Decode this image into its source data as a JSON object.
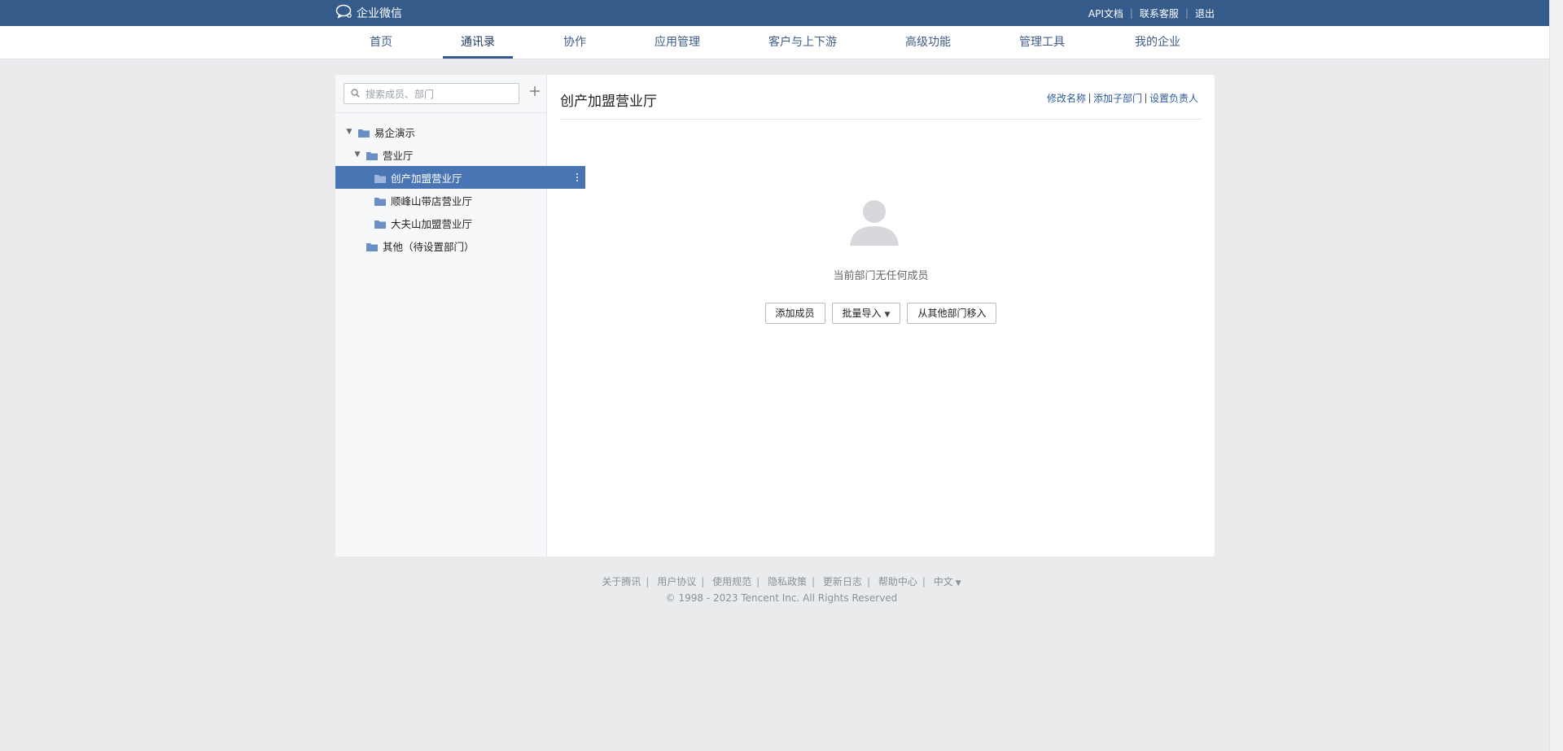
{
  "topbar": {
    "app_name": "企业微信",
    "links": [
      "API文档",
      "联系客服",
      "退出"
    ]
  },
  "nav": {
    "tabs": [
      "首页",
      "通讯录",
      "协作",
      "应用管理",
      "客户与上下游",
      "高级功能",
      "管理工具",
      "我的企业"
    ],
    "active": "通讯录"
  },
  "sidebar": {
    "search_placeholder": "搜索成员、部门",
    "tree": [
      {
        "label": "易企演示",
        "level": 0,
        "expanded": true
      },
      {
        "label": "营业厅",
        "level": 1,
        "expanded": true
      },
      {
        "label": "创产加盟营业厅",
        "level": 2,
        "selected": true
      },
      {
        "label": "顺峰山带店营业厅",
        "level": 2
      },
      {
        "label": "大夫山加盟营业厅",
        "level": 2
      },
      {
        "label": "其他（待设置部门）",
        "level": 1
      }
    ]
  },
  "content": {
    "title": "创产加盟营业厅",
    "actions": [
      "修改名称",
      "添加子部门",
      "设置负责人"
    ],
    "empty_text": "当前部门无任何成员",
    "buttons": {
      "add_member": "添加成员",
      "batch_import": "批量导入",
      "move_from_other": "从其他部门移入"
    }
  },
  "footer": {
    "links": [
      "关于腾讯",
      "用户协议",
      "使用规范",
      "隐私政策",
      "更新日志",
      "帮助中心"
    ],
    "language": "中文",
    "copyright": "© 1998 - 2023 Tencent Inc. All Rights Reserved"
  },
  "colors": {
    "topbar": "#355b8b",
    "selected_item": "#4a75b5",
    "link": "#2b5a96",
    "background": "#eaebed"
  }
}
